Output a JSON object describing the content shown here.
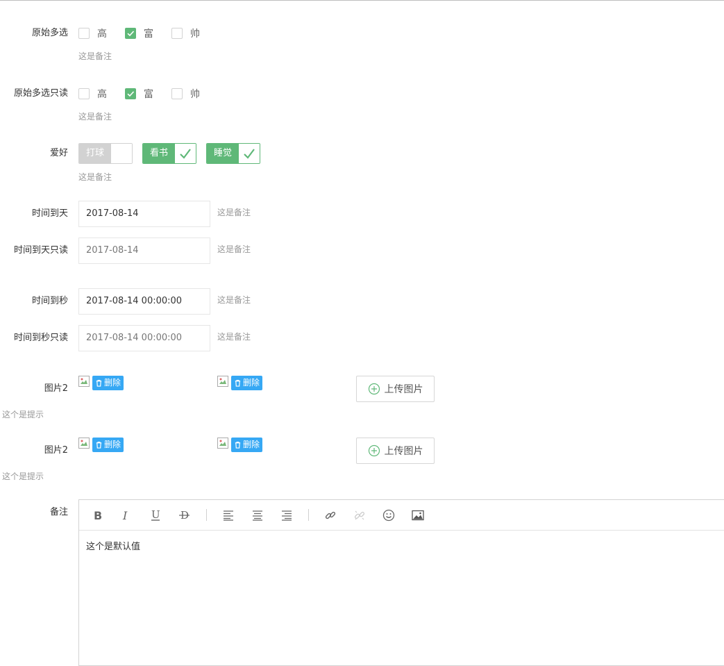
{
  "checkbox_field": {
    "label": "原始多选",
    "note": "这是备注",
    "options": [
      {
        "label": "高",
        "checked": false
      },
      {
        "label": "富",
        "checked": true
      },
      {
        "label": "帅",
        "checked": false
      }
    ]
  },
  "checkbox_readonly_field": {
    "label": "原始多选只读",
    "note": "这是备注",
    "options": [
      {
        "label": "高",
        "checked": false
      },
      {
        "label": "富",
        "checked": true
      },
      {
        "label": "帅",
        "checked": false
      }
    ]
  },
  "hobby_field": {
    "label": "爱好",
    "note": "这是备注",
    "options": [
      {
        "label": "打球",
        "checked": false
      },
      {
        "label": "看书",
        "checked": true
      },
      {
        "label": "睡觉",
        "checked": true
      }
    ]
  },
  "date_field": {
    "label": "时间到天",
    "value": "2017-08-14",
    "note": "这是备注"
  },
  "date_readonly_field": {
    "label": "时间到天只读",
    "value": "2017-08-14",
    "note": "这是备注"
  },
  "datetime_field": {
    "label": "时间到秒",
    "value": "2017-08-14 00:00:00",
    "note": "这是备注"
  },
  "datetime_readonly_field": {
    "label": "时间到秒只读",
    "value": "2017-08-14 00:00:00",
    "note": "这是备注"
  },
  "image_field_1": {
    "label": "图片2",
    "hint": "这个是提示",
    "delete_label": "删除",
    "upload_label": "上传图片"
  },
  "image_field_2": {
    "label": "图片2",
    "hint": "这个是提示",
    "delete_label": "删除",
    "upload_label": "上传图片"
  },
  "remark_field": {
    "label": "备注",
    "content": "这个是默认值",
    "toolbar": [
      "bold-icon",
      "italic-icon",
      "underline-icon",
      "strikethrough-icon",
      "align-left-icon",
      "align-center-icon",
      "align-right-icon",
      "link-icon",
      "unlink-icon",
      "emoji-icon",
      "image-icon"
    ]
  },
  "colors": {
    "accent_green": "#5fb878",
    "delete_blue": "#36a8f4",
    "note_gray": "#999999"
  }
}
